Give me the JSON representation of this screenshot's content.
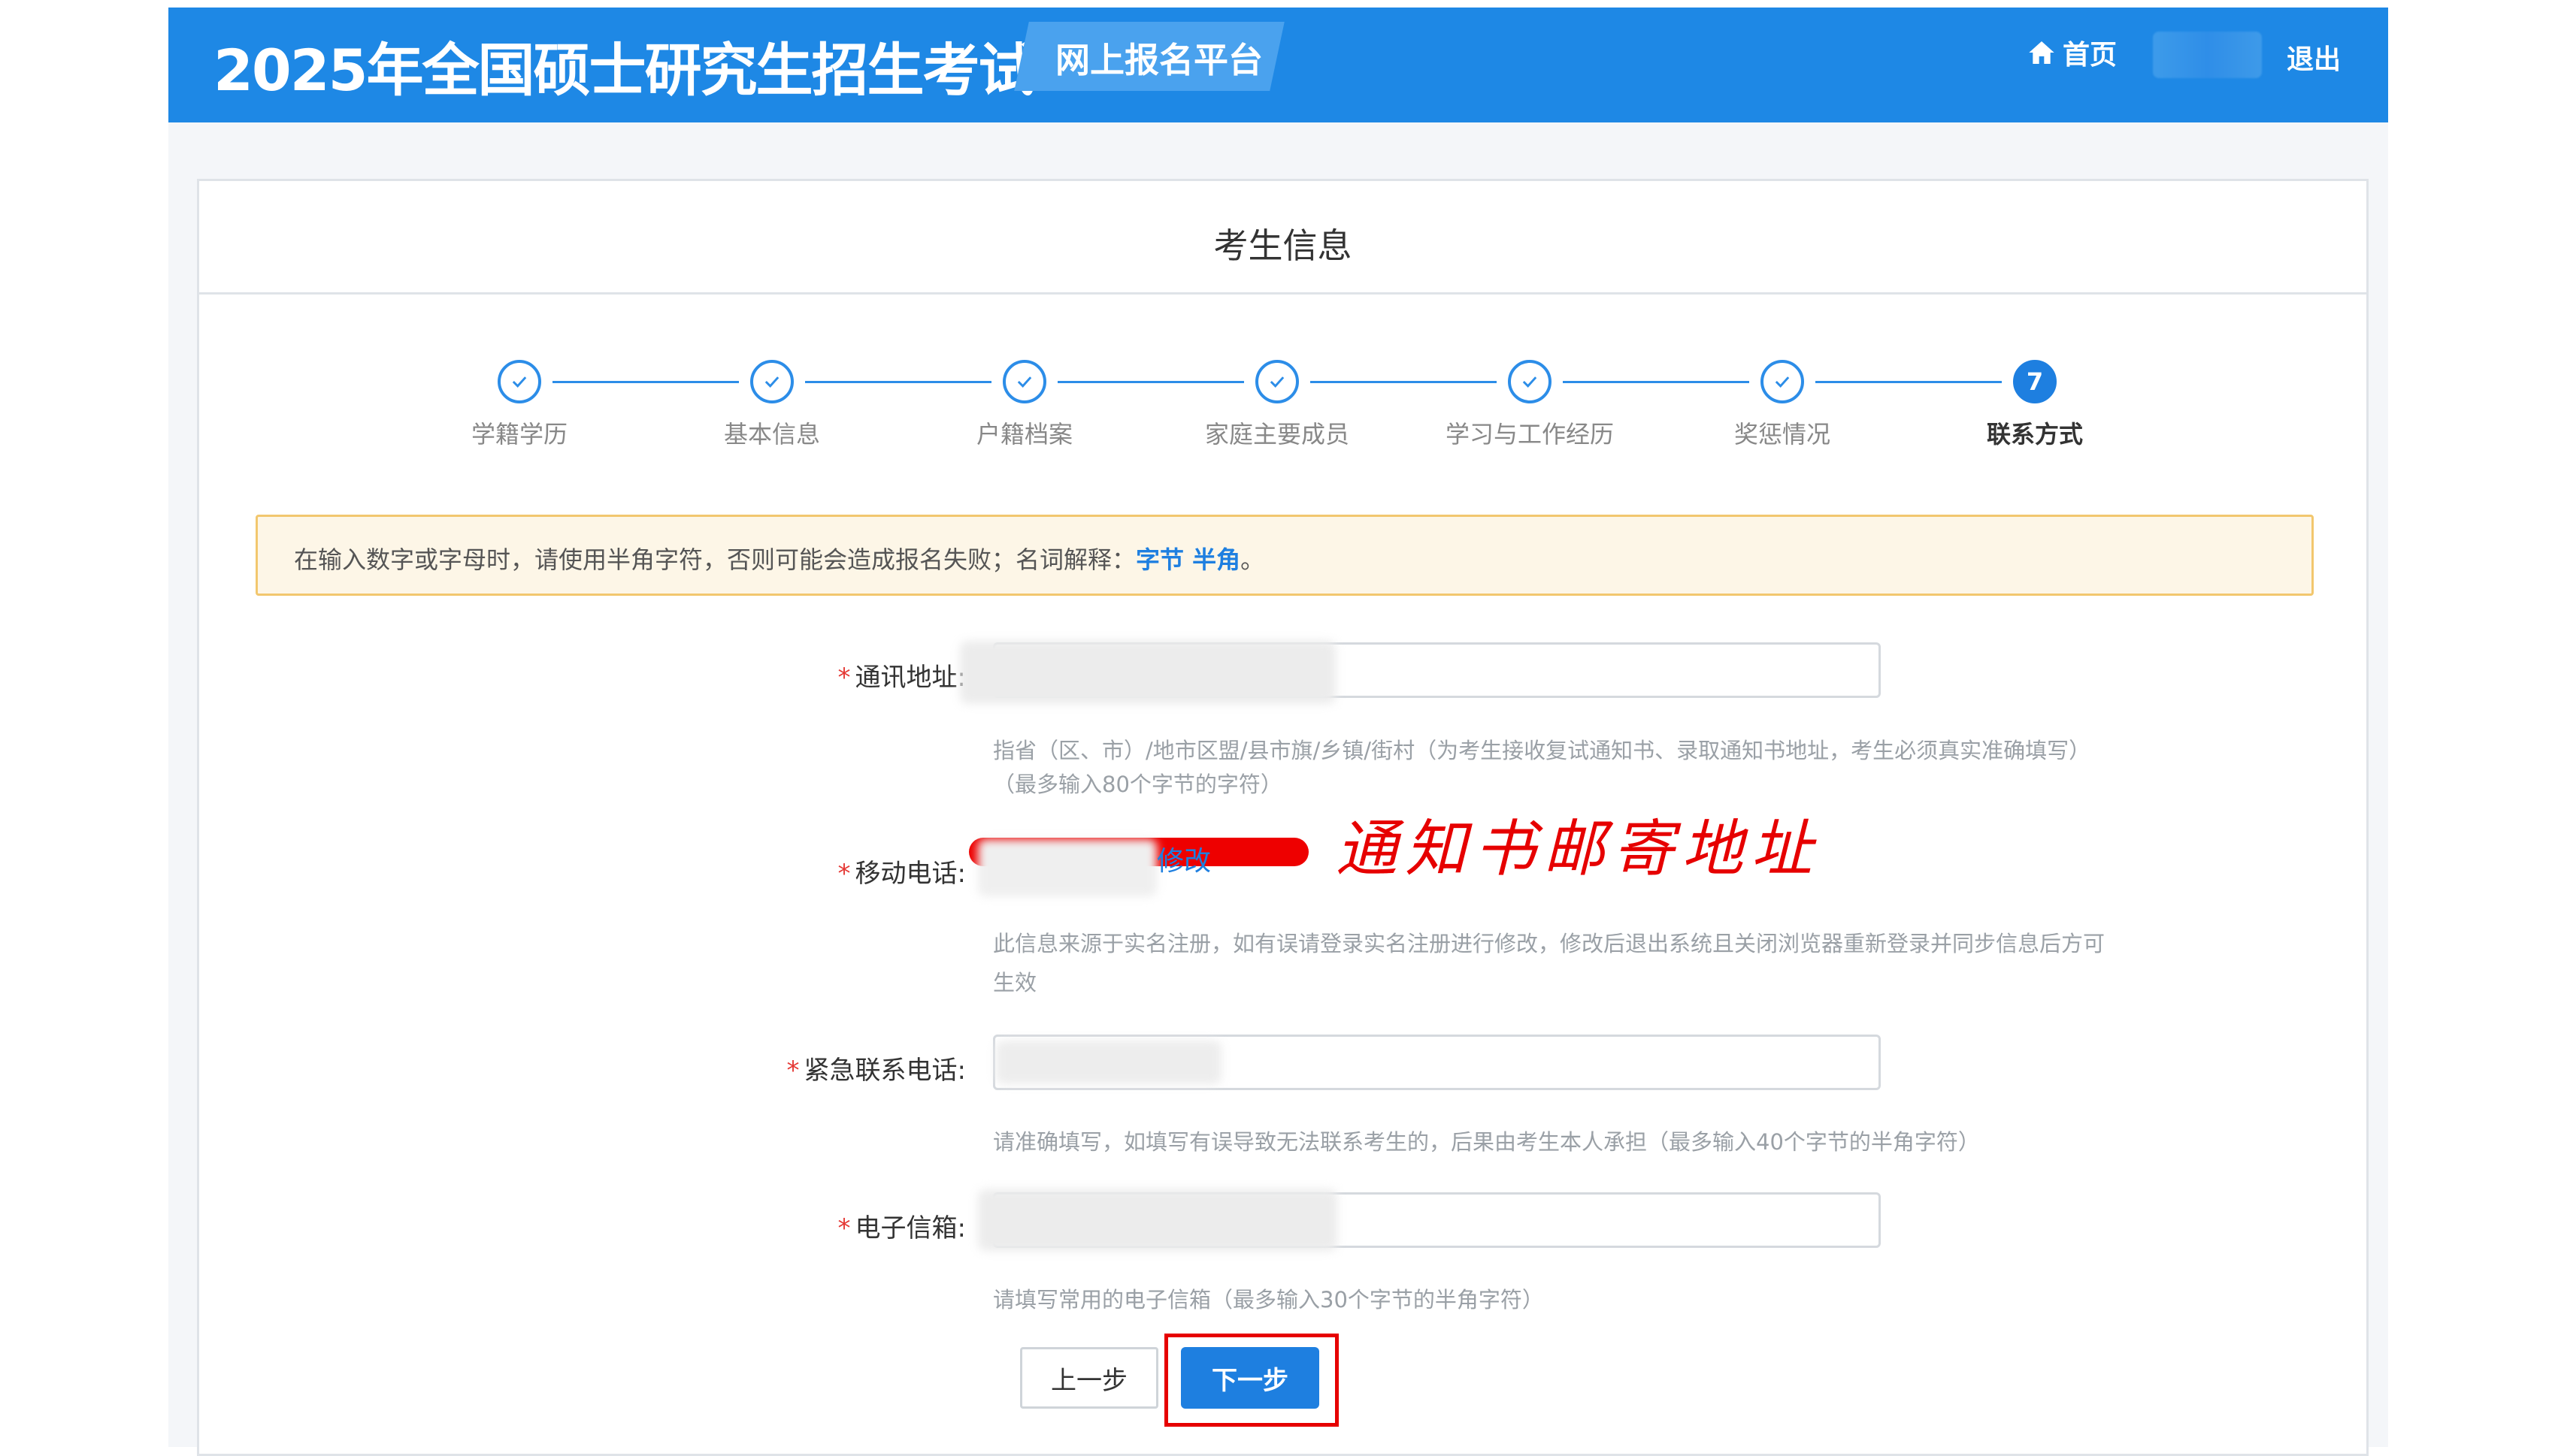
{
  "header": {
    "title": "2025年全国硕士研究生招生考试",
    "badge": "网上报名平台",
    "home_label": "首页",
    "logout_label": "退出"
  },
  "card": {
    "title": "考生信息"
  },
  "steps": [
    {
      "label": "学籍学历",
      "status": "done"
    },
    {
      "label": "基本信息",
      "status": "done"
    },
    {
      "label": "户籍档案",
      "status": "done"
    },
    {
      "label": "家庭主要成员",
      "status": "done"
    },
    {
      "label": "学习与工作经历",
      "status": "done"
    },
    {
      "label": "奖惩情况",
      "status": "done"
    },
    {
      "label": "联系方式",
      "status": "active",
      "number": "7"
    }
  ],
  "notice": {
    "text": "在输入数字或字母时，请使用半角字符，否则可能会造成报名失败；名词解释：",
    "link": "字节 半角",
    "end": "。"
  },
  "form": {
    "address": {
      "label": "通讯地址:",
      "annotation": "通知书邮寄地址",
      "hint1": "指省（区、市）/地市区盟/县市旗/乡镇/街村（为考生接收复试通知书、录取通知书地址，考生必须真实准确填写）",
      "hint2": "（最多输入80个字节的字符）"
    },
    "mobile": {
      "label": "移动电话:",
      "modify": "修改",
      "hint1": "此信息来源于实名注册，如有误请登录实名注册进行修改，修改后退出系统且关闭浏览器重新登录并同步信息后方可",
      "hint2": "生效"
    },
    "emergency": {
      "label": "紧急联系电话:",
      "hint": "请准确填写，如填写有误导致无法联系考生的，后果由考生本人承担（最多输入40个字节的半角字符）"
    },
    "email": {
      "label": "电子信箱:",
      "hint": "请填写常用的电子信箱（最多输入30个字节的半角字符）"
    }
  },
  "buttons": {
    "prev": "上一步",
    "next": "下一步"
  },
  "colors": {
    "primary": "#1e88e5",
    "required": "#e53935",
    "annotation": "#e60000",
    "notice_bg": "#fdf6e7"
  }
}
